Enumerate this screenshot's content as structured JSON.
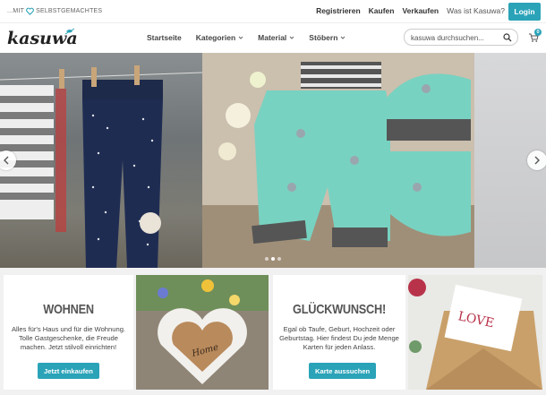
{
  "topbar": {
    "tagline_prefix": "...MIT",
    "tagline_suffix": "SELBSTGEMACHTES",
    "links": {
      "register": "Registrieren",
      "buy": "Kaufen",
      "sell": "Verkaufen",
      "about": "Was ist Kasuwa?"
    },
    "login": "Login"
  },
  "header": {
    "logo_text": "kasuwa",
    "nav": {
      "home": "Startseite",
      "categories": "Kategorien",
      "material": "Material",
      "browse": "Stöbern"
    },
    "search": {
      "placeholder": "kasuwa durchsuchen..."
    },
    "cart_count": "0"
  },
  "hero": {
    "slides": 3,
    "active_slide": 1
  },
  "tiles": {
    "wohnen": {
      "title": "WOHNEN",
      "desc": "Alles für's Haus und für die Wohnung. Tolle Gastgeschenke, die Freude machen. Jetzt stilvoll einrichten!",
      "button": "Jetzt einkaufen"
    },
    "heart_image": {
      "text": "Home"
    },
    "glueckwunsch": {
      "title": "GLÜCKWUNSCH!",
      "desc": "Egal ob Taufe, Geburt, Hochzeit oder Geburtstag. Hier findest Du jede Menge Karten für jeden Anlass.",
      "button": "Karte aussuchen"
    },
    "love_image": {
      "text": "LOVE"
    }
  },
  "colors": {
    "accent": "#2aa3b8"
  }
}
